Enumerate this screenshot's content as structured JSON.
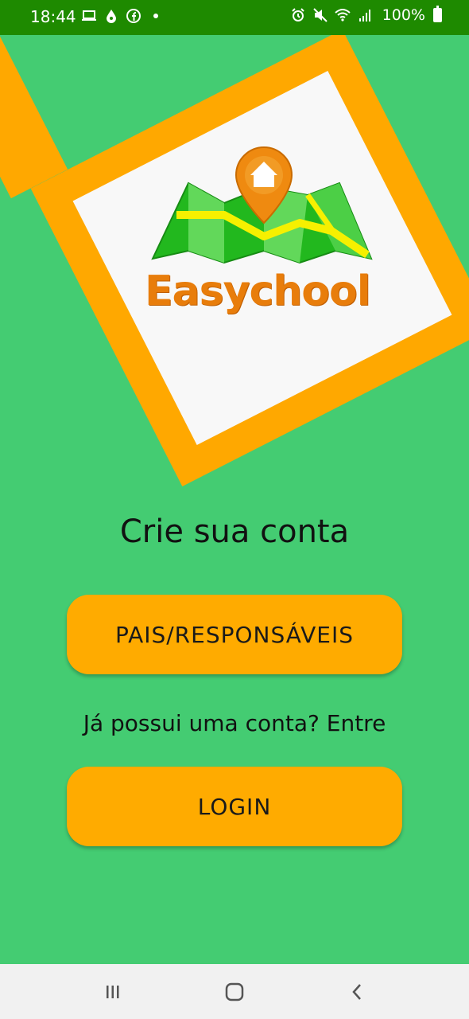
{
  "status_bar": {
    "time": "18:44",
    "battery": "100%",
    "left_icons": [
      "laptop-icon",
      "drop-icon",
      "facebook-icon",
      "dot-icon"
    ],
    "right_icons": [
      "alarm-icon",
      "mute-icon",
      "wifi-icon",
      "signal-icon",
      "battery-icon"
    ]
  },
  "brand": {
    "logo_text": "Easychool",
    "colors": {
      "background": "#44cc72",
      "accent": "#ffa800",
      "logo_text": "#e87d0b",
      "status_bar": "#1e8a00"
    }
  },
  "main": {
    "title": "Crie sua conta",
    "parents_button": "PAIS/RESPONSÁVEIS",
    "have_account_text": "Já possui uma conta? Entre",
    "login_button": "LOGIN"
  },
  "navbar": {
    "items": [
      "recent-apps-icon",
      "home-icon",
      "back-icon"
    ]
  }
}
